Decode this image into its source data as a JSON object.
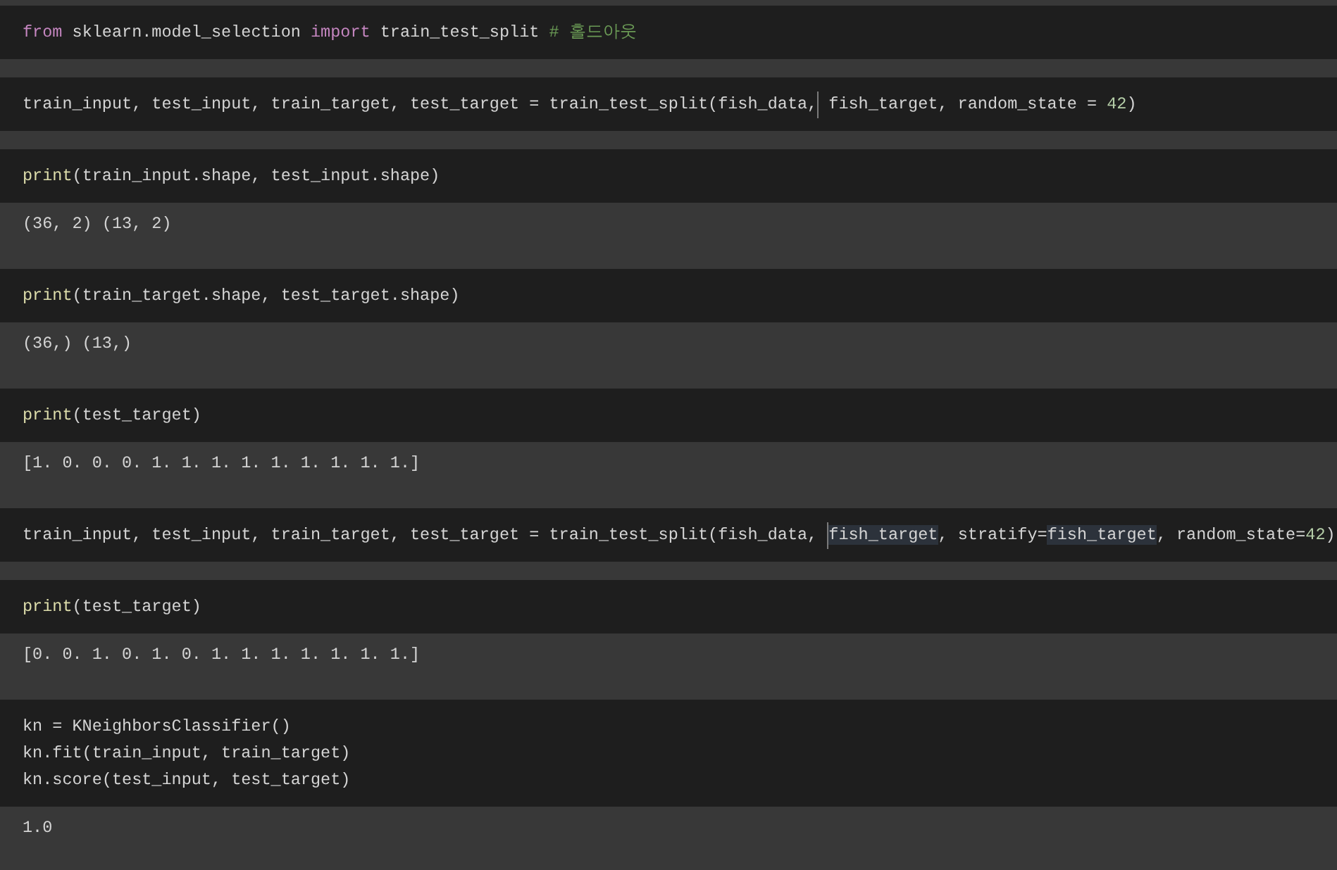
{
  "cells": [
    {
      "lines": [
        [
          {
            "kind": "keyword",
            "text": "from"
          },
          {
            "kind": "plain",
            "text": " sklearn.model_selection "
          },
          {
            "kind": "keyword",
            "text": "import"
          },
          {
            "kind": "plain",
            "text": " train_test_split "
          },
          {
            "kind": "comment",
            "text": "# 홀드아웃"
          }
        ]
      ]
    },
    {
      "lines": [
        [
          {
            "kind": "plain",
            "text": "train_input, test_input, train_target, test_target = train_test_split(fish_data,"
          },
          {
            "kind": "cursor"
          },
          {
            "kind": "plain",
            "text": " fish_target, random_state = "
          },
          {
            "kind": "number",
            "text": "42"
          },
          {
            "kind": "plain",
            "text": ")"
          }
        ]
      ]
    },
    {
      "lines": [
        [
          {
            "kind": "builtin",
            "text": "print"
          },
          {
            "kind": "plain",
            "text": "(train_input.shape, test_input.shape)"
          }
        ]
      ],
      "output": "(36, 2) (13, 2)"
    },
    {
      "lines": [
        [
          {
            "kind": "builtin",
            "text": "print"
          },
          {
            "kind": "plain",
            "text": "(train_target.shape, test_target.shape)"
          }
        ]
      ],
      "output": "(36,) (13,)"
    },
    {
      "lines": [
        [
          {
            "kind": "builtin",
            "text": "print"
          },
          {
            "kind": "plain",
            "text": "(test_target)"
          }
        ]
      ],
      "output": "[1. 0. 0. 0. 1. 1. 1. 1. 1. 1. 1. 1. 1.]"
    },
    {
      "lines": [
        [
          {
            "kind": "plain",
            "text": "train_input, test_input, train_target, test_target = train_test_split(fish_data, "
          },
          {
            "kind": "cursor"
          },
          {
            "kind": "match",
            "text": "fish_target"
          },
          {
            "kind": "plain",
            "text": ", stratify="
          },
          {
            "kind": "match",
            "text": "fish_target"
          },
          {
            "kind": "plain",
            "text": ", random_state="
          },
          {
            "kind": "number",
            "text": "42"
          },
          {
            "kind": "plain",
            "text": ")"
          }
        ]
      ]
    },
    {
      "lines": [
        [
          {
            "kind": "builtin",
            "text": "print"
          },
          {
            "kind": "plain",
            "text": "(test_target)"
          }
        ]
      ],
      "output": "[0. 0. 1. 0. 1. 0. 1. 1. 1. 1. 1. 1. 1.]"
    },
    {
      "lines": [
        [
          {
            "kind": "plain",
            "text": "kn = KNeighborsClassifier()"
          }
        ],
        [
          {
            "kind": "plain",
            "text": "kn.fit(train_input, train_target)"
          }
        ],
        [
          {
            "kind": "plain",
            "text": "kn.score(test_input, test_target)"
          }
        ]
      ],
      "output": "1.0"
    }
  ]
}
